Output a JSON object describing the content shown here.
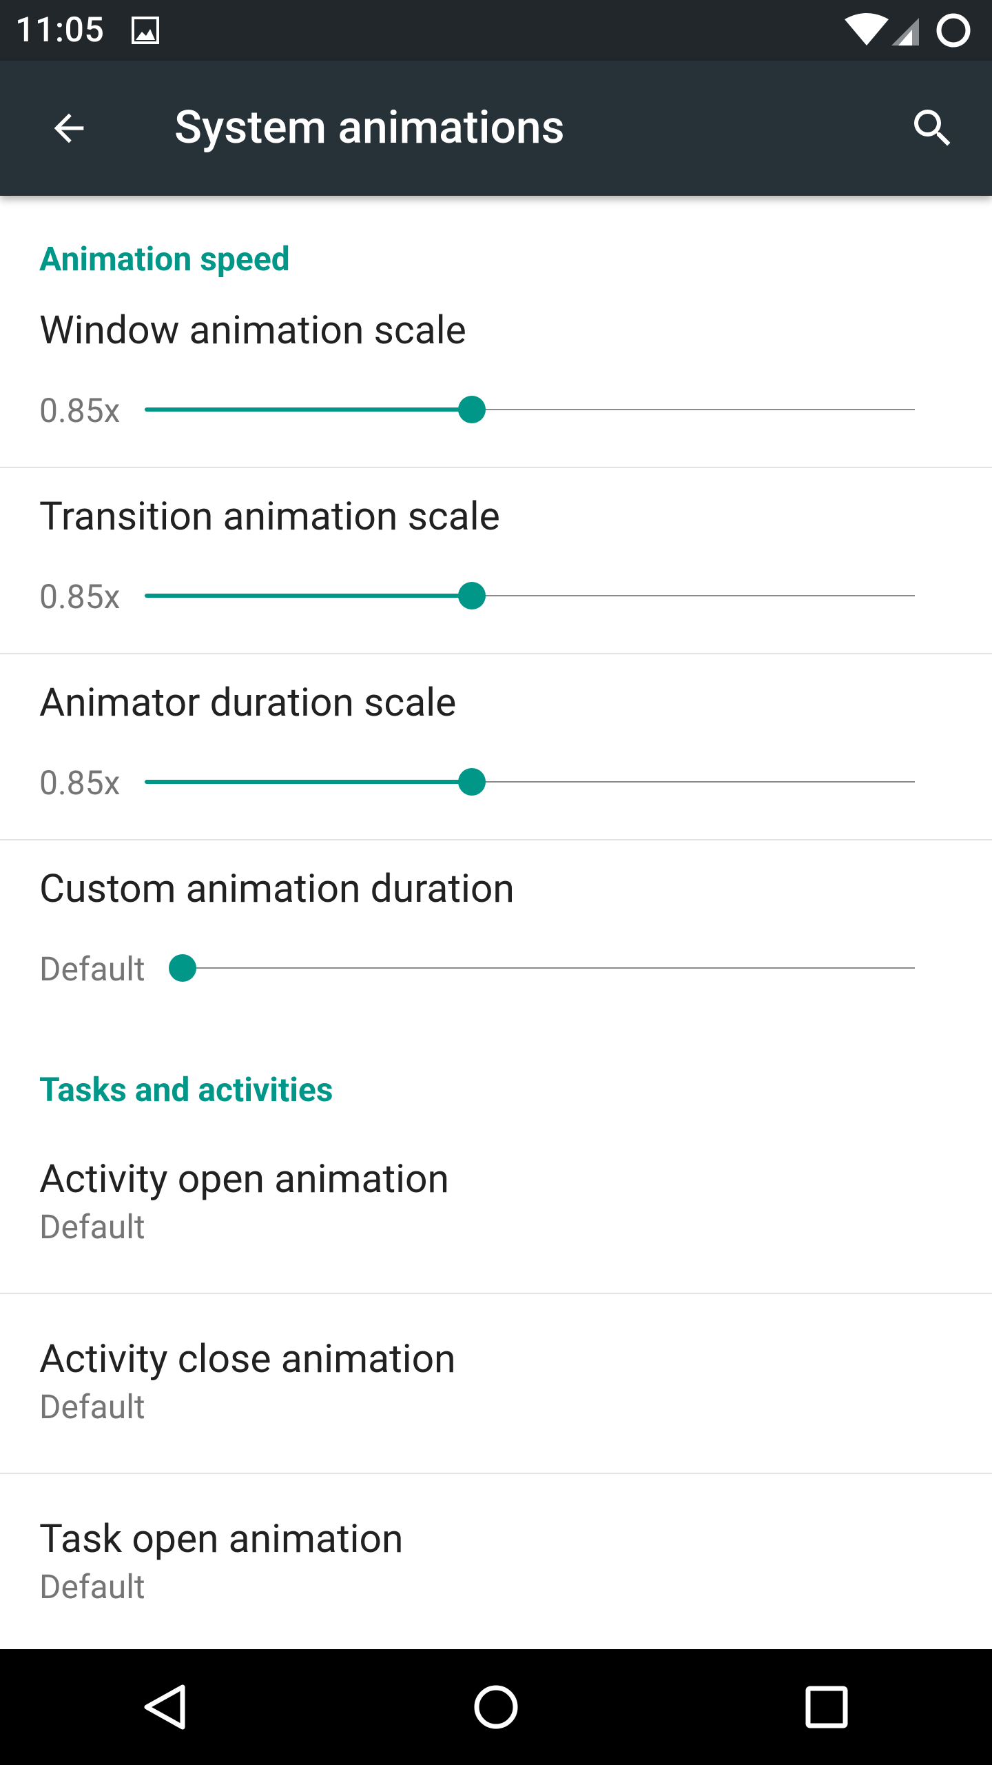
{
  "status_bar": {
    "time": "11:05",
    "icons": [
      "image-notification-icon",
      "wifi-icon",
      "cell-signal-icon",
      "battery-ring-icon"
    ]
  },
  "app_bar": {
    "title": "System animations",
    "back_icon": "arrow-back-icon",
    "search_icon": "search-icon"
  },
  "colors": {
    "accent": "#009688",
    "toolbar": "#263238",
    "status_bar": "#21272b",
    "nav_bar": "#000000",
    "primary_text": "#212121",
    "secondary_text": "#757575"
  },
  "sections": {
    "animation_speed": {
      "header": "Animation speed",
      "sliders": [
        {
          "title": "Window animation scale",
          "value_label": "0.85x",
          "fraction": 0.425
        },
        {
          "title": "Transition animation scale",
          "value_label": "0.85x",
          "fraction": 0.425
        },
        {
          "title": "Animator duration scale",
          "value_label": "0.85x",
          "fraction": 0.425
        },
        {
          "title": "Custom animation duration",
          "value_label": "Default",
          "fraction": 0.0
        }
      ]
    },
    "tasks_activities": {
      "header": "Tasks and activities",
      "items": [
        {
          "title": "Activity open animation",
          "summary": "Default"
        },
        {
          "title": "Activity close animation",
          "summary": "Default"
        },
        {
          "title": "Task open animation",
          "summary": "Default"
        }
      ]
    }
  },
  "nav_bar": {
    "back_icon": "nav-back-triangle-icon",
    "home_icon": "nav-home-circle-icon",
    "recents_icon": "nav-recents-square-icon"
  }
}
